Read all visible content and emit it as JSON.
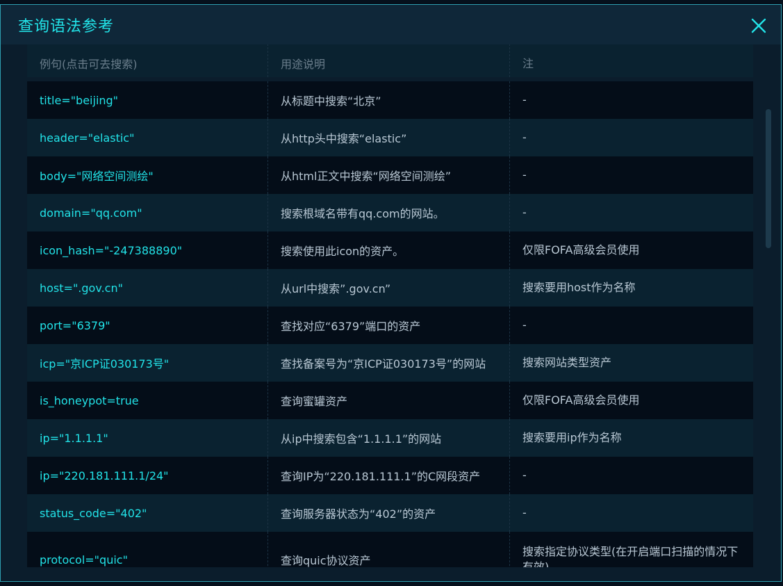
{
  "dialog": {
    "title": "查询语法参考",
    "close_icon": "close-icon"
  },
  "table": {
    "headers": [
      "例句(点击可去搜索)",
      "用途说明",
      "注"
    ],
    "rows": [
      {
        "example": "title=\"beijing\"",
        "usage": "从标题中搜索“北京”",
        "note": "-"
      },
      {
        "example": "header=\"elastic\"",
        "usage": "从http头中搜索“elastic”",
        "note": "-"
      },
      {
        "example": "body=\"网络空间测绘\"",
        "usage": "从html正文中搜索“网络空间测绘”",
        "note": "-"
      },
      {
        "example": "domain=\"qq.com\"",
        "usage": "搜索根域名带有qq.com的网站。",
        "note": "-"
      },
      {
        "example": "icon_hash=\"-247388890\"",
        "usage": "搜索使用此icon的资产。",
        "note": "仅限FOFA高级会员使用"
      },
      {
        "example": "host=\".gov.cn\"",
        "usage": "从url中搜索”.gov.cn”",
        "note": "搜索要用host作为名称"
      },
      {
        "example": "port=\"6379\"",
        "usage": "查找对应“6379”端口的资产",
        "note": "-"
      },
      {
        "example": "icp=\"京ICP证030173号\"",
        "usage": "查找备案号为“京ICP证030173号”的网站",
        "note": "搜索网站类型资产"
      },
      {
        "example": "is_honeypot=true",
        "usage": "查询蜜罐资产",
        "note": "仅限FOFA高级会员使用"
      },
      {
        "example": "ip=\"1.1.1.1\"",
        "usage": "从ip中搜索包含“1.1.1.1”的网站",
        "note": "搜索要用ip作为名称"
      },
      {
        "example": "ip=\"220.181.111.1/24\"",
        "usage": "查询IP为“220.181.111.1”的C网段资产",
        "note": "-"
      },
      {
        "example": "status_code=\"402\"",
        "usage": "查询服务器状态为“402”的资产",
        "note": "-"
      },
      {
        "example": "protocol=\"quic\"",
        "usage": "查询quic协议资产",
        "note": "搜索指定协议类型(在开启端口扫描的情况下有效)"
      }
    ]
  }
}
